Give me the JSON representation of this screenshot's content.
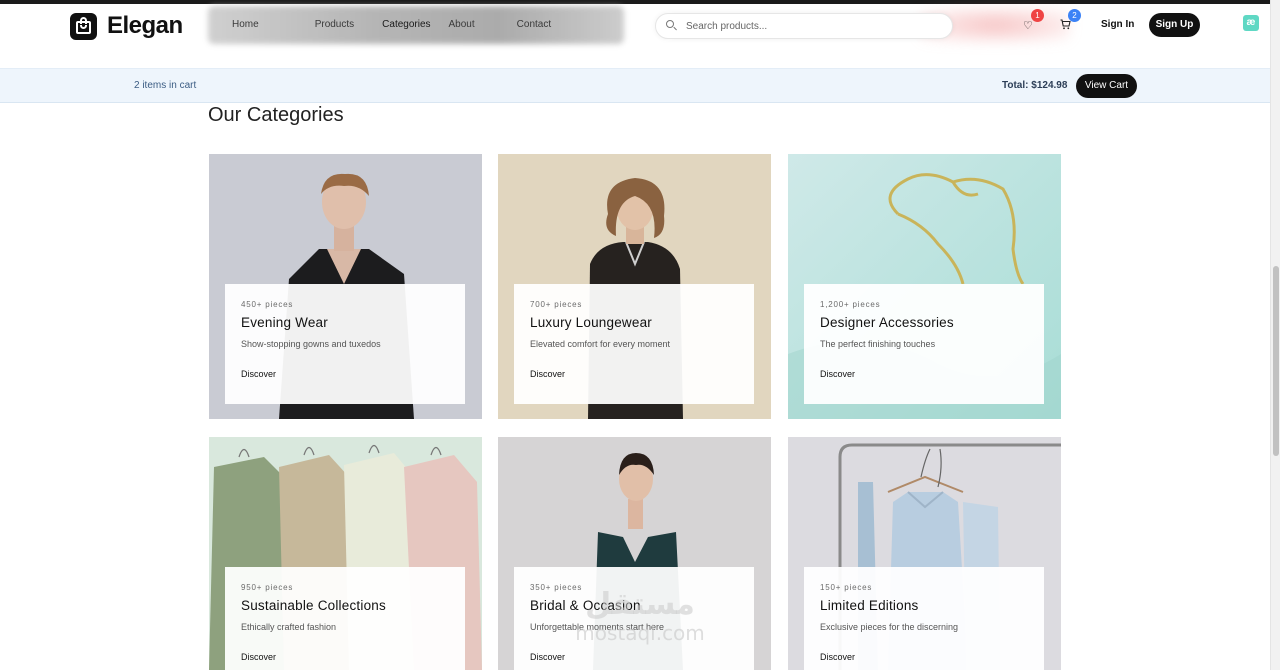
{
  "brand": {
    "name": "Elegan"
  },
  "nav": {
    "items": [
      {
        "label": "Home"
      },
      {
        "label": "Products"
      },
      {
        "label": "Categories"
      },
      {
        "label": "About"
      },
      {
        "label": "Contact"
      }
    ]
  },
  "search": {
    "placeholder": "Search products..."
  },
  "header": {
    "wishlist_count": "1",
    "cart_count": "2",
    "signin_label": "Sign In",
    "signup_label": "Sign Up",
    "extension_glyph": "æ"
  },
  "cartbar": {
    "items_text": "2 items in cart",
    "total_text": "Total: $124.98",
    "view_cart_label": "View Cart"
  },
  "section": {
    "title": "Our Categories"
  },
  "categories": [
    {
      "pieces": "450+ pieces",
      "name": "Evening Wear",
      "desc": "Show-stopping gowns and tuxedos",
      "cta": "Discover",
      "icon": "man-in-black-blazer"
    },
    {
      "pieces": "700+ pieces",
      "name": "Luxury Loungewear",
      "desc": "Elevated comfort for every moment",
      "cta": "Discover",
      "icon": "woman-in-pajamas"
    },
    {
      "pieces": "1,200+ pieces",
      "name": "Designer Accessories",
      "desc": "The perfect finishing touches",
      "cta": "Discover",
      "icon": "gold-chain-necklace"
    },
    {
      "pieces": "950+ pieces",
      "name": "Sustainable Collections",
      "desc": "Ethically crafted fashion",
      "cta": "Discover",
      "icon": "shirts-on-hangers"
    },
    {
      "pieces": "350+ pieces",
      "name": "Bridal & Occasion",
      "desc": "Unforgettable moments start here",
      "cta": "Discover",
      "icon": "woman-in-green-gown"
    },
    {
      "pieces": "150+ pieces",
      "name": "Limited Editions",
      "desc": "Exclusive pieces for the discerning",
      "cta": "Discover",
      "icon": "clothing-rack"
    }
  ],
  "watermark": {
    "arabic": "مستقل",
    "latin": "mostaql.com"
  },
  "colors": {
    "accent": "#111111",
    "cartbar_bg": "#eef5fc",
    "badge_red": "#ef4444",
    "badge_blue": "#3b82f6"
  }
}
